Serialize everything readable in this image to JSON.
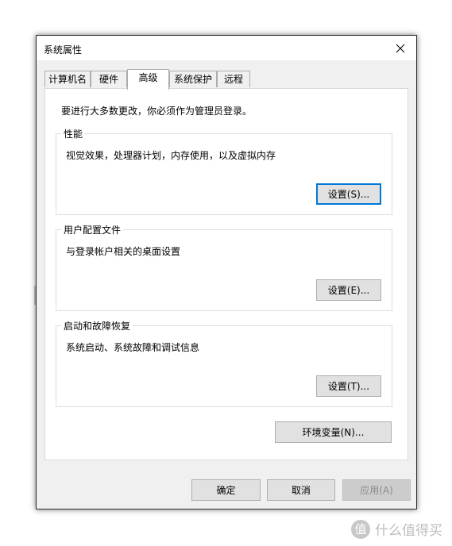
{
  "window": {
    "title": "系统属性",
    "close_label": "×"
  },
  "tabs": [
    {
      "label": "计算机名",
      "active": false
    },
    {
      "label": "硬件",
      "active": false
    },
    {
      "label": "高级",
      "active": true
    },
    {
      "label": "系统保护",
      "active": false
    },
    {
      "label": "远程",
      "active": false
    }
  ],
  "advanced": {
    "admin_note": "要进行大多数更改，你必须作为管理员登录。",
    "performance": {
      "title": "性能",
      "description": "视觉效果，处理器计划，内存使用，以及虚拟内存",
      "button": "设置(S)..."
    },
    "user_profiles": {
      "title": "用户配置文件",
      "description": "与登录帐户相关的桌面设置",
      "button": "设置(E)..."
    },
    "startup_recovery": {
      "title": "启动和故障恢复",
      "description": "系统启动、系统故障和调试信息",
      "button": "设置(T)..."
    },
    "env_button": "环境变量(N)..."
  },
  "footer": {
    "ok": "确定",
    "cancel": "取消",
    "apply": "应用(A)"
  },
  "watermark": {
    "logo_glyph": "值",
    "text": "什么值得买"
  }
}
